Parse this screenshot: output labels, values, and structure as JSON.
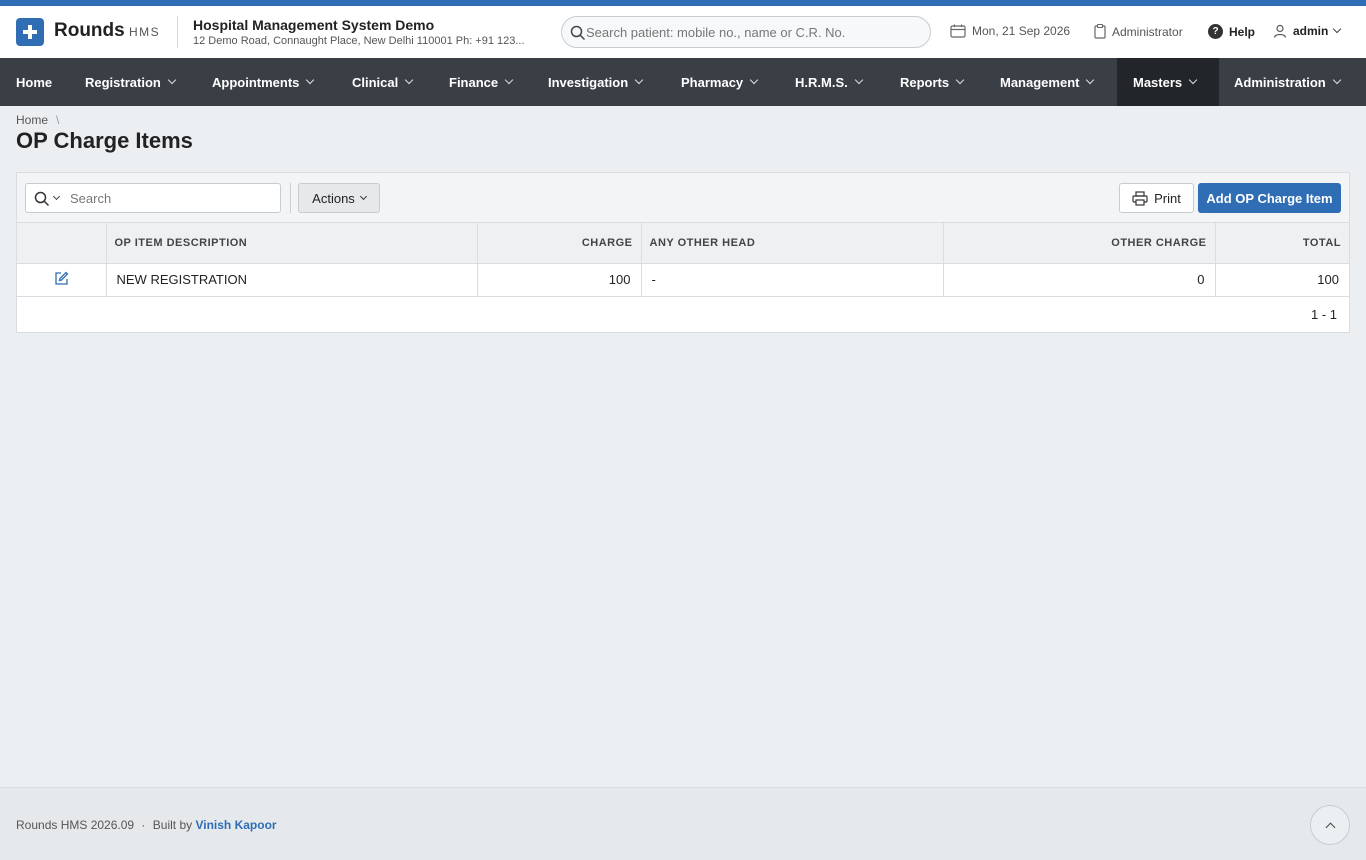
{
  "brand": {
    "name": "Rounds",
    "suffix": "HMS"
  },
  "hospital": {
    "name": "Hospital Management System Demo",
    "address": "12 Demo Road, Connaught Place, New Delhi 110001 Ph: +91 123..."
  },
  "patient_search": {
    "placeholder": "Search patient: mobile no., name or C.R. No."
  },
  "header": {
    "date": "Mon, 21 Sep 2026",
    "role": "Administrator",
    "help": "Help",
    "user": "admin"
  },
  "nav": [
    {
      "label": "Home",
      "has_menu": false
    },
    {
      "label": "Registration",
      "has_menu": true
    },
    {
      "label": "Appointments",
      "has_menu": true
    },
    {
      "label": "Clinical",
      "has_menu": true
    },
    {
      "label": "Finance",
      "has_menu": true
    },
    {
      "label": "Investigation",
      "has_menu": true
    },
    {
      "label": "Pharmacy",
      "has_menu": true
    },
    {
      "label": "H.R.M.S.",
      "has_menu": true
    },
    {
      "label": "Reports",
      "has_menu": true
    },
    {
      "label": "Management",
      "has_menu": true
    },
    {
      "label": "Masters",
      "has_menu": true,
      "active": true
    },
    {
      "label": "Administration",
      "has_menu": true
    }
  ],
  "breadcrumb": {
    "home": "Home",
    "separator": "\\"
  },
  "page": {
    "title": "OP Charge Items"
  },
  "toolbar": {
    "search_placeholder": "Search",
    "actions_label": "Actions",
    "print_label": "Print",
    "add_label": "Add OP Charge Item"
  },
  "table": {
    "columns": [
      "",
      "OP ITEM DESCRIPTION",
      "CHARGE",
      "ANY OTHER HEAD",
      "OTHER CHARGE",
      "TOTAL"
    ],
    "rows": [
      {
        "description": "NEW REGISTRATION",
        "charge": "100",
        "other_head": "-",
        "other_charge": "0",
        "total": "100"
      }
    ],
    "pagination": "1 - 1"
  },
  "footer": {
    "version": "Rounds HMS 2026.09",
    "separator": "·",
    "built_by": "Built by",
    "author": "Vinish Kapoor"
  },
  "colors": {
    "accent": "#2f6db5",
    "nav_bg": "#3a3f46",
    "nav_active": "#22262b",
    "page_bg": "#eceff2"
  }
}
